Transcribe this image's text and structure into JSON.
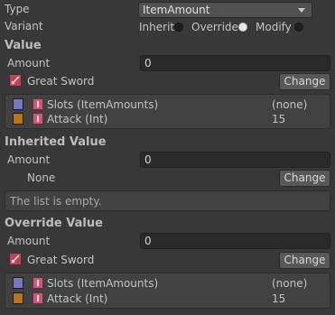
{
  "type": {
    "label": "Type",
    "value": "ItemAmount"
  },
  "variant": {
    "label": "Variant",
    "options": [
      "Inherit",
      "Override",
      "Modify"
    ],
    "selected": "Override"
  },
  "value_section": {
    "title": "Value",
    "amount_label": "Amount",
    "amount_value": "0",
    "item_name": "Great Sword",
    "change_label": "Change",
    "attributes": [
      {
        "name": "Slots (ItemAmounts)",
        "value": "(none)",
        "color": "#7a75c0"
      },
      {
        "name": "Attack (Int)",
        "value": "15",
        "color": "#b8721f"
      }
    ]
  },
  "inherited_section": {
    "title": "Inherited Value",
    "amount_label": "Amount",
    "amount_value": "0",
    "item_name": "None",
    "change_label": "Change",
    "empty_text": "The list is empty."
  },
  "override_section": {
    "title": "Override Value",
    "amount_label": "Amount",
    "amount_value": "0",
    "item_name": "Great Sword",
    "change_label": "Change",
    "attributes": [
      {
        "name": "Slots (ItemAmounts)",
        "value": "(none)",
        "color": "#7a75c0"
      },
      {
        "name": "Attack (Int)",
        "value": "15",
        "color": "#b8721f"
      }
    ]
  }
}
